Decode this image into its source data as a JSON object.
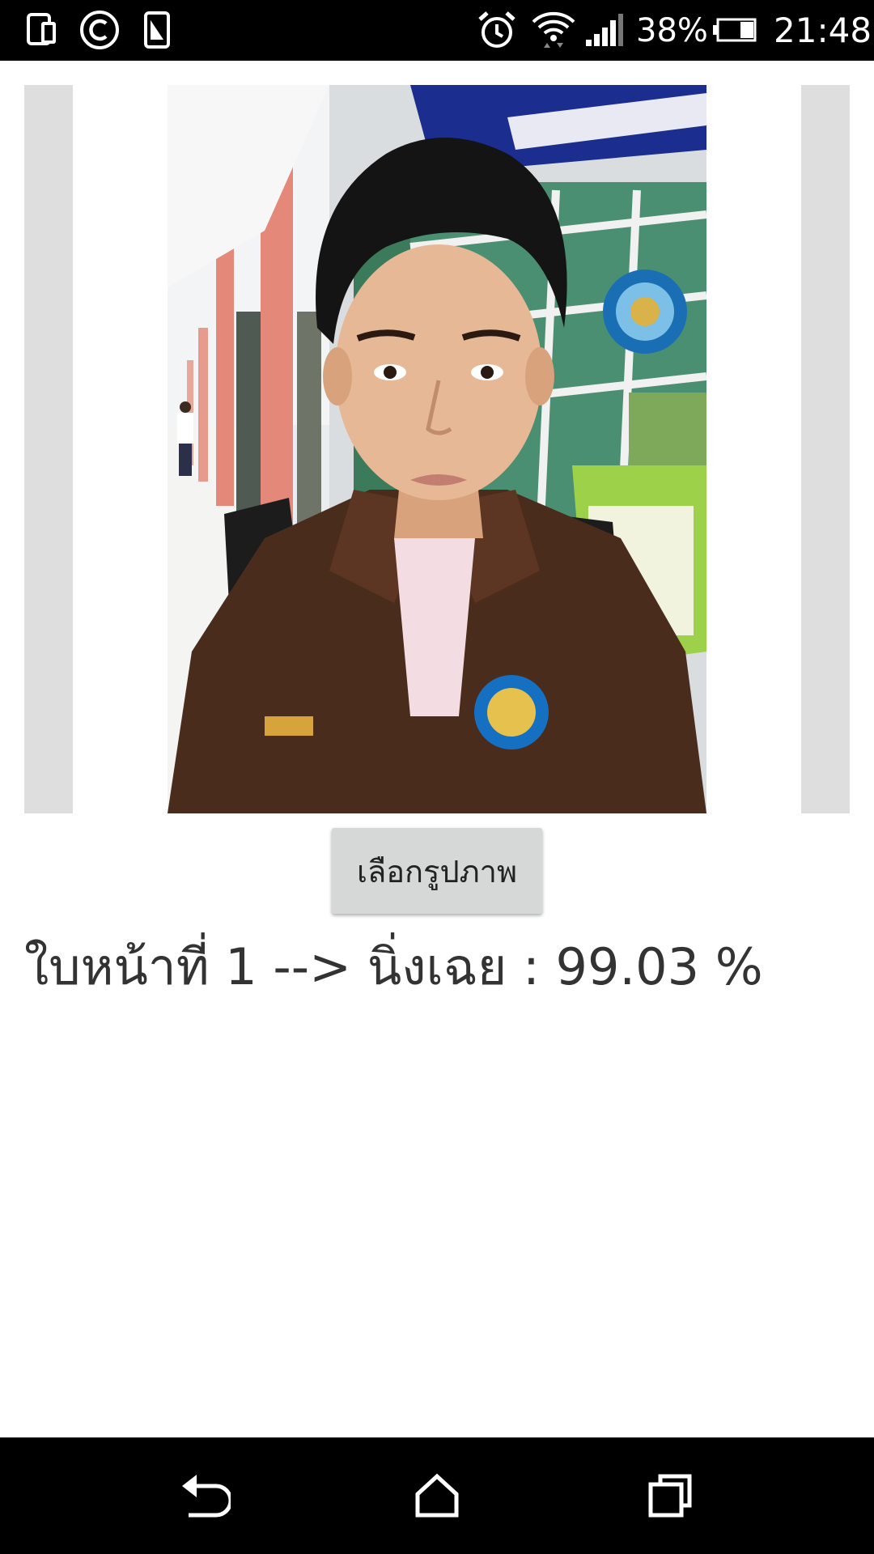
{
  "status_bar": {
    "battery_percent": "38%",
    "battery_level": 0.38,
    "time": "21:48",
    "icons": [
      "sim-card-icon",
      "copyright-icon",
      "screenshot-icon",
      "alarm-icon",
      "wifi-icon",
      "signal-icon",
      "battery-icon"
    ]
  },
  "main": {
    "photo": {
      "description_icon": "selected-photo"
    },
    "pick_button_label": "เลือกรูปภาพ",
    "result": {
      "text": "ใบหน้าที่ 1 --> นิ่งเฉย :  99.03 %"
    }
  },
  "nav_bar": {
    "icons": [
      "back-icon",
      "home-icon",
      "recents-icon"
    ]
  },
  "colors": {
    "status_bar_bg": "#000000",
    "nav_bar_bg": "#000000",
    "button_bg": "#d6d7d7",
    "side_bar_bg": "#dedede",
    "text": "#333333"
  }
}
